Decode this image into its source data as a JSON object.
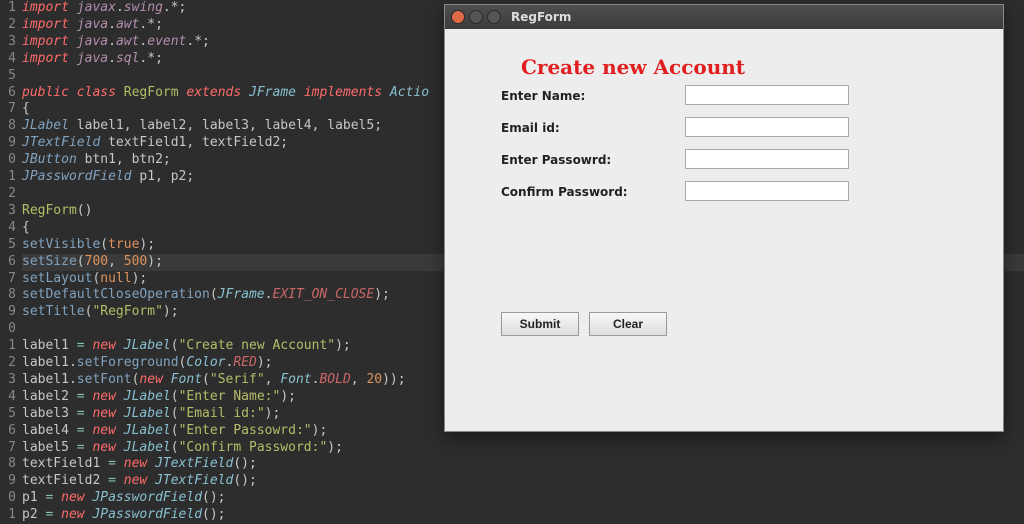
{
  "editor": {
    "lines": [
      {
        "n": "1",
        "t": [
          [
            "kw",
            "import"
          ],
          [
            "punc",
            " "
          ],
          [
            "pkg",
            "javax"
          ],
          [
            "punc",
            "."
          ],
          [
            "pkg",
            "swing"
          ],
          [
            "punc",
            ".*;"
          ]
        ]
      },
      {
        "n": "2",
        "t": [
          [
            "kw",
            "import"
          ],
          [
            "punc",
            " "
          ],
          [
            "pkg",
            "java"
          ],
          [
            "punc",
            "."
          ],
          [
            "pkg",
            "awt"
          ],
          [
            "punc",
            ".*;"
          ]
        ]
      },
      {
        "n": "3",
        "t": [
          [
            "kw",
            "import"
          ],
          [
            "punc",
            " "
          ],
          [
            "pkg",
            "java"
          ],
          [
            "punc",
            "."
          ],
          [
            "pkg",
            "awt"
          ],
          [
            "punc",
            "."
          ],
          [
            "pkg",
            "event"
          ],
          [
            "punc",
            ".*;"
          ]
        ]
      },
      {
        "n": "4",
        "t": [
          [
            "kw",
            "import"
          ],
          [
            "punc",
            " "
          ],
          [
            "pkg",
            "java"
          ],
          [
            "punc",
            "."
          ],
          [
            "pkg",
            "sql"
          ],
          [
            "punc",
            ".*;"
          ]
        ]
      },
      {
        "n": "5",
        "t": [
          [
            "punc",
            ""
          ]
        ]
      },
      {
        "n": "6",
        "t": [
          [
            "kw",
            "public"
          ],
          [
            "punc",
            " "
          ],
          [
            "kw",
            "class"
          ],
          [
            "punc",
            " "
          ],
          [
            "fnname",
            "RegForm"
          ],
          [
            "punc",
            " "
          ],
          [
            "kw",
            "extends"
          ],
          [
            "punc",
            " "
          ],
          [
            "cls",
            "JFrame"
          ],
          [
            "punc",
            " "
          ],
          [
            "kw",
            "implements"
          ],
          [
            "punc",
            " "
          ],
          [
            "cls",
            "Actio"
          ]
        ]
      },
      {
        "n": "7",
        "t": [
          [
            "punc",
            "{"
          ]
        ]
      },
      {
        "n": "8",
        "t": [
          [
            "cls2",
            "JLabel"
          ],
          [
            "punc",
            " "
          ],
          [
            "idf",
            "label1, label2, label3, label4, label5;"
          ]
        ]
      },
      {
        "n": "9",
        "t": [
          [
            "cls2",
            "JTextField"
          ],
          [
            "punc",
            " "
          ],
          [
            "idf",
            "textField1, textField2;"
          ]
        ]
      },
      {
        "n": "0",
        "t": [
          [
            "cls2",
            "JButton"
          ],
          [
            "punc",
            " "
          ],
          [
            "idf",
            "btn1, btn2;"
          ]
        ]
      },
      {
        "n": "1",
        "t": [
          [
            "cls2",
            "JPasswordField"
          ],
          [
            "punc",
            " "
          ],
          [
            "idf",
            "p1, p2;"
          ]
        ]
      },
      {
        "n": "2",
        "t": [
          [
            "punc",
            ""
          ]
        ]
      },
      {
        "n": "3",
        "t": [
          [
            "fnname",
            "RegForm"
          ],
          [
            "punc",
            "()"
          ]
        ]
      },
      {
        "n": "4",
        "t": [
          [
            "punc",
            "{"
          ]
        ]
      },
      {
        "n": "5",
        "t": [
          [
            "fn",
            "setVisible"
          ],
          [
            "punc",
            "("
          ],
          [
            "bool",
            "true"
          ],
          [
            "punc",
            ");"
          ]
        ]
      },
      {
        "n": "6",
        "cur": true,
        "t": [
          [
            "fn",
            "setSize"
          ],
          [
            "punc",
            "("
          ],
          [
            "num",
            "700"
          ],
          [
            "punc",
            ", "
          ],
          [
            "num",
            "500"
          ],
          [
            "punc",
            ");"
          ]
        ]
      },
      {
        "n": "7",
        "t": [
          [
            "fn",
            "setLayout"
          ],
          [
            "punc",
            "("
          ],
          [
            "bool",
            "null"
          ],
          [
            "punc",
            ");"
          ]
        ]
      },
      {
        "n": "8",
        "t": [
          [
            "fn",
            "setDefaultCloseOperation"
          ],
          [
            "punc",
            "("
          ],
          [
            "cls",
            "JFrame"
          ],
          [
            "punc",
            "."
          ],
          [
            "const2",
            "EXIT_ON_CLOSE"
          ],
          [
            "punc",
            ");"
          ]
        ]
      },
      {
        "n": "9",
        "t": [
          [
            "fn",
            "setTitle"
          ],
          [
            "punc",
            "("
          ],
          [
            "str",
            "\"RegForm\""
          ],
          [
            "punc",
            ");"
          ]
        ]
      },
      {
        "n": "0",
        "t": [
          [
            "punc",
            ""
          ]
        ]
      },
      {
        "n": "1",
        "t": [
          [
            "idf",
            "label1 "
          ],
          [
            "op",
            "="
          ],
          [
            "punc",
            " "
          ],
          [
            "kw",
            "new"
          ],
          [
            "punc",
            " "
          ],
          [
            "cls",
            "JLabel"
          ],
          [
            "punc",
            "("
          ],
          [
            "str",
            "\"Create new Account\""
          ],
          [
            "punc",
            ");"
          ]
        ]
      },
      {
        "n": "2",
        "t": [
          [
            "idf",
            "label1"
          ],
          [
            "punc",
            "."
          ],
          [
            "fn",
            "setForeground"
          ],
          [
            "punc",
            "("
          ],
          [
            "cls",
            "Color"
          ],
          [
            "punc",
            "."
          ],
          [
            "const2",
            "RED"
          ],
          [
            "punc",
            ");"
          ]
        ]
      },
      {
        "n": "3",
        "t": [
          [
            "idf",
            "label1"
          ],
          [
            "punc",
            "."
          ],
          [
            "fn",
            "setFont"
          ],
          [
            "punc",
            "("
          ],
          [
            "kw",
            "new"
          ],
          [
            "punc",
            " "
          ],
          [
            "cls",
            "Font"
          ],
          [
            "punc",
            "("
          ],
          [
            "str",
            "\"Serif\""
          ],
          [
            "punc",
            ", "
          ],
          [
            "cls",
            "Font"
          ],
          [
            "punc",
            "."
          ],
          [
            "const2",
            "BOLD"
          ],
          [
            "punc",
            ", "
          ],
          [
            "num",
            "20"
          ],
          [
            "punc",
            "));"
          ]
        ]
      },
      {
        "n": "4",
        "t": [
          [
            "idf",
            "label2 "
          ],
          [
            "op",
            "="
          ],
          [
            "punc",
            " "
          ],
          [
            "kw",
            "new"
          ],
          [
            "punc",
            " "
          ],
          [
            "cls",
            "JLabel"
          ],
          [
            "punc",
            "("
          ],
          [
            "str",
            "\"Enter Name:\""
          ],
          [
            "punc",
            ");"
          ]
        ]
      },
      {
        "n": "5",
        "t": [
          [
            "idf",
            "label3 "
          ],
          [
            "op",
            "="
          ],
          [
            "punc",
            " "
          ],
          [
            "kw",
            "new"
          ],
          [
            "punc",
            " "
          ],
          [
            "cls",
            "JLabel"
          ],
          [
            "punc",
            "("
          ],
          [
            "str",
            "\"Email id:\""
          ],
          [
            "punc",
            ");"
          ]
        ]
      },
      {
        "n": "6",
        "t": [
          [
            "idf",
            "label4 "
          ],
          [
            "op",
            "="
          ],
          [
            "punc",
            " "
          ],
          [
            "kw",
            "new"
          ],
          [
            "punc",
            " "
          ],
          [
            "cls",
            "JLabel"
          ],
          [
            "punc",
            "("
          ],
          [
            "str",
            "\"Enter Passowrd:\""
          ],
          [
            "punc",
            ");"
          ]
        ]
      },
      {
        "n": "7",
        "t": [
          [
            "idf",
            "label5 "
          ],
          [
            "op",
            "="
          ],
          [
            "punc",
            " "
          ],
          [
            "kw",
            "new"
          ],
          [
            "punc",
            " "
          ],
          [
            "cls",
            "JLabel"
          ],
          [
            "punc",
            "("
          ],
          [
            "str",
            "\"Confirm Password:\""
          ],
          [
            "punc",
            ");"
          ]
        ]
      },
      {
        "n": "8",
        "t": [
          [
            "idf",
            "textField1 "
          ],
          [
            "op",
            "="
          ],
          [
            "punc",
            " "
          ],
          [
            "kw",
            "new"
          ],
          [
            "punc",
            " "
          ],
          [
            "cls",
            "JTextField"
          ],
          [
            "punc",
            "();"
          ]
        ]
      },
      {
        "n": "9",
        "t": [
          [
            "idf",
            "textField2 "
          ],
          [
            "op",
            "="
          ],
          [
            "punc",
            " "
          ],
          [
            "kw",
            "new"
          ],
          [
            "punc",
            " "
          ],
          [
            "cls",
            "JTextField"
          ],
          [
            "punc",
            "();"
          ]
        ]
      },
      {
        "n": "0",
        "t": [
          [
            "idf",
            "p1 "
          ],
          [
            "op",
            "="
          ],
          [
            "punc",
            " "
          ],
          [
            "kw",
            "new"
          ],
          [
            "punc",
            " "
          ],
          [
            "cls",
            "JPasswordField"
          ],
          [
            "punc",
            "();"
          ]
        ]
      },
      {
        "n": "1",
        "t": [
          [
            "idf",
            "p2 "
          ],
          [
            "op",
            "="
          ],
          [
            "punc",
            " "
          ],
          [
            "kw",
            "new"
          ],
          [
            "punc",
            " "
          ],
          [
            "cls",
            "JPasswordField"
          ],
          [
            "punc",
            "();"
          ]
        ]
      }
    ]
  },
  "window": {
    "title": "RegForm",
    "heading": "Create new Account",
    "labels": {
      "name": "Enter Name:",
      "email": "Email id:",
      "password": "Enter Passowrd:",
      "confirm": "Confirm Password:"
    },
    "fields": {
      "name": "",
      "email": "",
      "password": "",
      "confirm": ""
    },
    "buttons": {
      "submit": "Submit",
      "clear": "Clear"
    }
  }
}
